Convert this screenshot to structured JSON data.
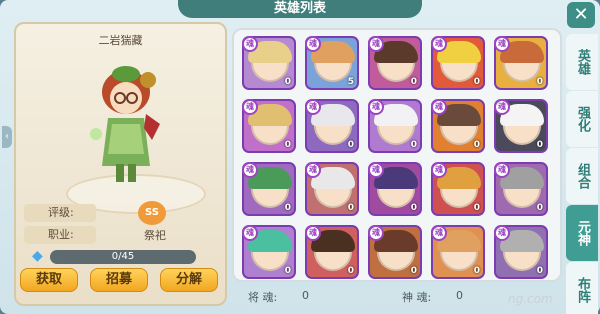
{
  "window": {
    "title": "英雄列表",
    "close_label": "✕"
  },
  "hero": {
    "name": "二岩猯藏",
    "rating_label": "评级:",
    "rating_badge": "SS",
    "role_label": "职业:",
    "role_value": "祭祀",
    "progress_text": "0/45",
    "progress": 0
  },
  "buttons": {
    "get": "获取",
    "recruit": "招募",
    "dismantle": "分解"
  },
  "grid": {
    "soul_label": "魂",
    "cards": [
      {
        "count": "0",
        "hair": "#e8cf8a",
        "bg": "#b58ad0"
      },
      {
        "count": "5",
        "hair": "#e0a060",
        "bg": "#7ba3d9"
      },
      {
        "count": "0",
        "hair": "#5a3a2a",
        "bg": "#c25b9b"
      },
      {
        "count": "0",
        "hair": "#f0d040",
        "bg": "#e25a3a"
      },
      {
        "count": "0",
        "hair": "#c86a3a",
        "bg": "#e8b040"
      },
      {
        "count": "0",
        "hair": "#e0c070",
        "bg": "#c070c8"
      },
      {
        "count": "0",
        "hair": "#e8e8ec",
        "bg": "#8d6ac0"
      },
      {
        "count": "0",
        "hair": "#f2f2f4",
        "bg": "#b07ad0"
      },
      {
        "count": "0",
        "hair": "#6a4a3a",
        "bg": "#e08030"
      },
      {
        "count": "0",
        "hair": "#f4f4f4",
        "bg": "#4a4a5a"
      },
      {
        "count": "0",
        "hair": "#4a9a5a",
        "bg": "#a06ac0"
      },
      {
        "count": "0",
        "hair": "#e8e8e8",
        "bg": "#c07070"
      },
      {
        "count": "0",
        "hair": "#4a3a7a",
        "bg": "#a04aa0"
      },
      {
        "count": "0",
        "hair": "#e0a040",
        "bg": "#d05050"
      },
      {
        "count": "0",
        "hair": "#a0a0a0",
        "bg": "#a06ab0"
      },
      {
        "count": "0",
        "hair": "#4ac0a0",
        "bg": "#b080d0"
      },
      {
        "count": "0",
        "hair": "#4a3020",
        "bg": "#d06060"
      },
      {
        "count": "0",
        "hair": "#6a3a2a",
        "bg": "#c07040"
      },
      {
        "count": "0",
        "hair": "#e0a060",
        "bg": "#e09050"
      },
      {
        "count": "0",
        "hair": "#b0b0b0",
        "bg": "#9070b0"
      }
    ]
  },
  "footer": {
    "general_soul_label": "将 魂:",
    "general_soul_value": "0",
    "god_soul_label": "神 魂:",
    "god_soul_value": "0"
  },
  "tabs": [
    {
      "label": "英雄"
    },
    {
      "label": "强化"
    },
    {
      "label": "组合"
    },
    {
      "label": "元神"
    },
    {
      "label": "布阵"
    }
  ],
  "watermark": "ng.com",
  "colors": {
    "accent": "#3f9d93",
    "button": "#f2a622",
    "card_border": "#7a3cb0"
  }
}
